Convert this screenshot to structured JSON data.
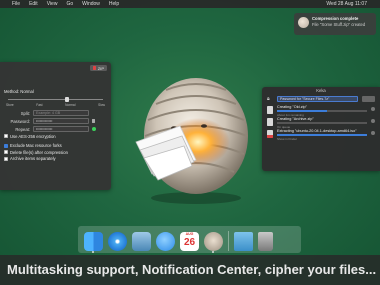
{
  "menubar": {
    "items": [
      "File",
      "Edit",
      "View",
      "Go",
      "Window",
      "Help"
    ],
    "right": [
      "Wed 28 Aug 11:07"
    ]
  },
  "notification": {
    "title": "Compression complete",
    "subtitle": "File \"Some Stuff.zip\" created"
  },
  "settings": {
    "format": "ZIP",
    "method_label": "Method: Normal",
    "slider_ticks": [
      "Store",
      "Fast",
      "Normal",
      "Slow"
    ],
    "split_label": "Split:",
    "split_placeholder": "Example: 4 GB",
    "password_label": "Password:",
    "password_value": "•••••••••••••",
    "repeat_label": "Repeat:",
    "repeat_value": "•••••••••••••",
    "aes_label": "Use AES-256 encryption",
    "exclude_label": "Exclude Mac resource forks",
    "delete_label": "Delete file(s) after compression",
    "archive_label": "Archive items separately"
  },
  "keka": {
    "title": "Keka",
    "password_placeholder": "Password for \"Secure Files.7z\"",
    "tasks": [
      {
        "name": "Creating \"Old.zip\"",
        "status": "About 1m remaining",
        "progress": 0.55
      },
      {
        "name": "Creating \"Archive.zip\"",
        "status": "On queue",
        "progress": 0
      },
      {
        "name": "Extracting \"ubuntu-20.04.1-desktop-amd64.iso\"",
        "status": "Show in Finder",
        "progress": 1
      }
    ]
  },
  "dock": {
    "calendar_month": "AUG",
    "calendar_day": "26"
  },
  "caption": "Multitasking support, Notification Center, cipher your files..."
}
